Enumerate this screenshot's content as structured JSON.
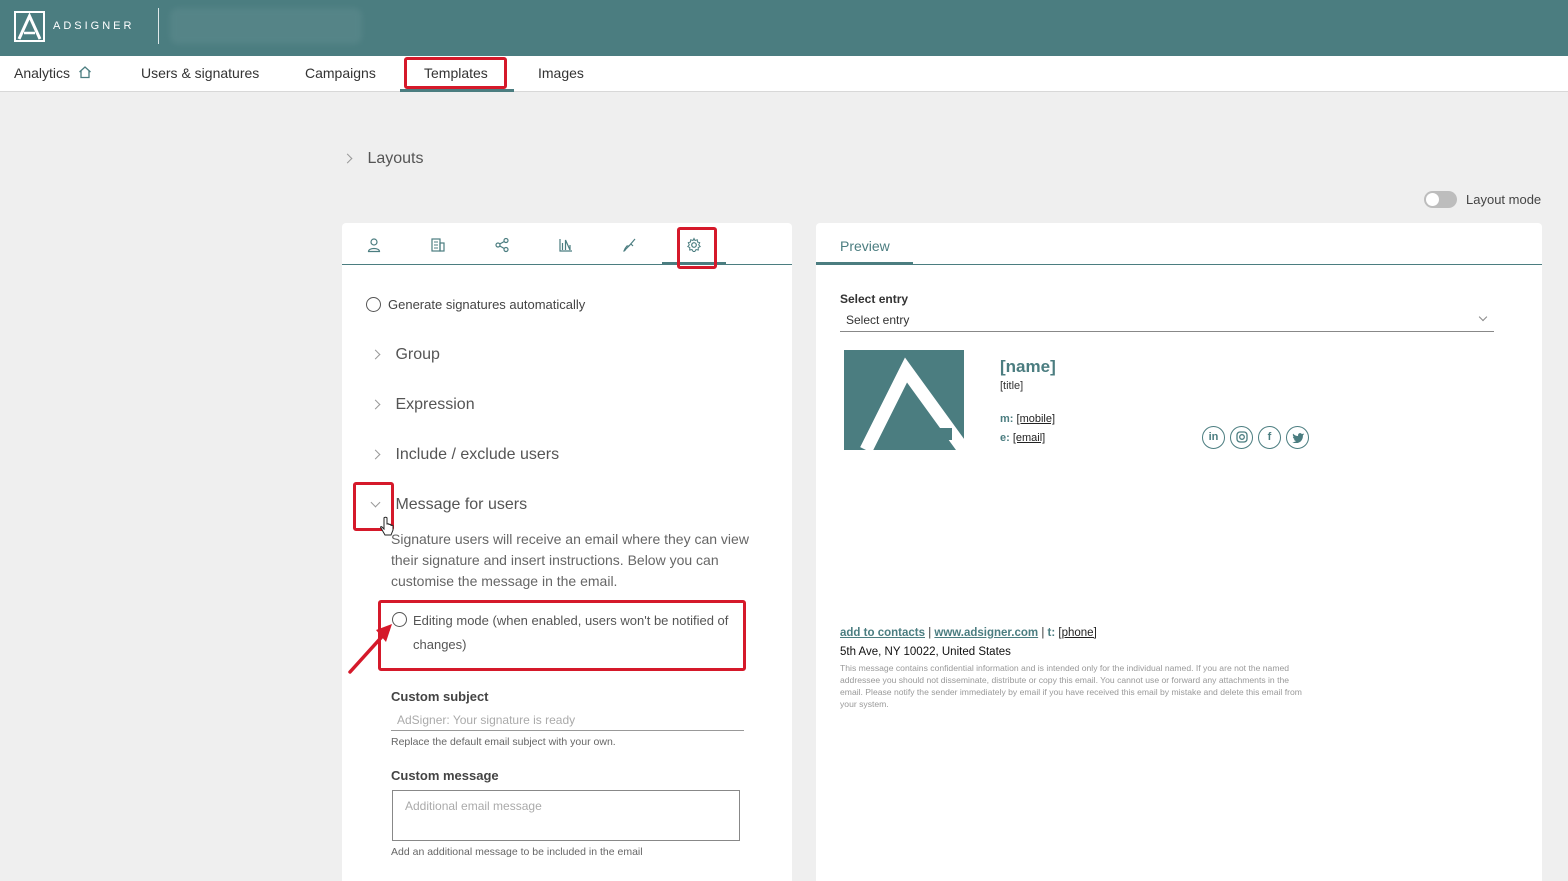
{
  "app": {
    "logo_text": "ADSIGNER"
  },
  "nav": {
    "analytics": "Analytics",
    "users": "Users & signatures",
    "campaigns": "Campaigns",
    "templates": "Templates",
    "images": "Images"
  },
  "layouts": {
    "label": "Layouts"
  },
  "layout_mode": {
    "label": "Layout mode",
    "enabled": false
  },
  "editor": {
    "tabs": [
      "user-icon",
      "company-icon",
      "share-icon",
      "chart-icon",
      "brush-icon",
      "gear-icon"
    ],
    "active_tab": "gear-icon",
    "generate_auto": "Generate signatures automatically",
    "group": "Group",
    "expression": "Expression",
    "include_exclude": "Include / exclude users",
    "message_for_users": "Message for users",
    "message_desc": "Signature users will receive an email where they can view their signature and insert instructions. Below you can customise the message in the email.",
    "editing_mode": "Editing mode (when enabled, users won't be notified of changes)",
    "custom_subject_label": "Custom subject",
    "custom_subject_placeholder": "AdSigner: Your signature is ready",
    "custom_subject_hint": "Replace the default email subject with your own.",
    "custom_message_label": "Custom message",
    "custom_message_placeholder": "Additional email message",
    "custom_message_hint": "Add an additional message to be included in the email"
  },
  "preview": {
    "tab": "Preview",
    "select_label": "Select entry",
    "select_value": "Select entry",
    "signature": {
      "name": "[name]",
      "title": "[title]",
      "mobile_prefix": "m:",
      "mobile": "[mobile]",
      "email_prefix": "e:",
      "email": "[email]",
      "social": [
        "linkedin-icon",
        "instagram-icon",
        "facebook-icon",
        "twitter-icon"
      ],
      "add_contacts": "add to contacts",
      "website": "www.adsigner.com",
      "phone_prefix": "t:",
      "phone": "[phone]",
      "address": "5th Ave, NY 10022, United States",
      "disclaimer": "This message contains confidential information and is intended only for the individual named. If you are not the named addressee you should not disseminate, distribute or copy this email. You cannot use or forward any attachments in the email. Please notify the sender immediately by email if you have received this email by mistake and delete this email from your system."
    },
    "brand_color": "#4b7d80",
    "highlight_color": "#d5192a"
  }
}
